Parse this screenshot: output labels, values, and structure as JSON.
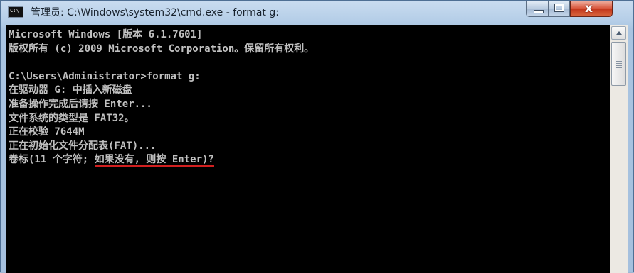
{
  "window": {
    "title": "管理员: C:\\Windows\\system32\\cmd.exe - format  g:",
    "icon_label": "C:\\",
    "controls": {
      "minimize": "minimize-icon",
      "maximize": "maximize-icon",
      "close": "close-icon",
      "close_glyph": "x"
    }
  },
  "console": {
    "lines": [
      {
        "pre": "Microsoft Windows [版本 6.1.7601]",
        "mark": "",
        "post": ""
      },
      {
        "pre": "版权所有 (c) 2009 Microsoft Corporation。保留所有权利。",
        "mark": "",
        "post": ""
      },
      {
        "pre": "",
        "mark": "",
        "post": ""
      },
      {
        "pre": "C:\\Users\\Administrator>format g:",
        "mark": "",
        "post": ""
      },
      {
        "pre": "在驱动器 G: 中插入新磁盘",
        "mark": "",
        "post": ""
      },
      {
        "pre": "准备操作完成后请按 Enter...",
        "mark": "",
        "post": ""
      },
      {
        "pre": "文件系统的类型是 FAT32。",
        "mark": "",
        "post": ""
      },
      {
        "pre": "正在校验 7644M",
        "mark": "",
        "post": ""
      },
      {
        "pre": "正在初始化文件分配表(FAT)...",
        "mark": "",
        "post": ""
      },
      {
        "pre": "卷标(11 个字符; ",
        "mark": "如果没有, 则按 Enter)?",
        "post": ""
      }
    ],
    "annotation_color": "#d11f1f",
    "text_color": "#c0c0c0",
    "background": "#000000"
  },
  "scrollbar": {
    "up_arrow": "scroll-up-arrow-icon"
  }
}
